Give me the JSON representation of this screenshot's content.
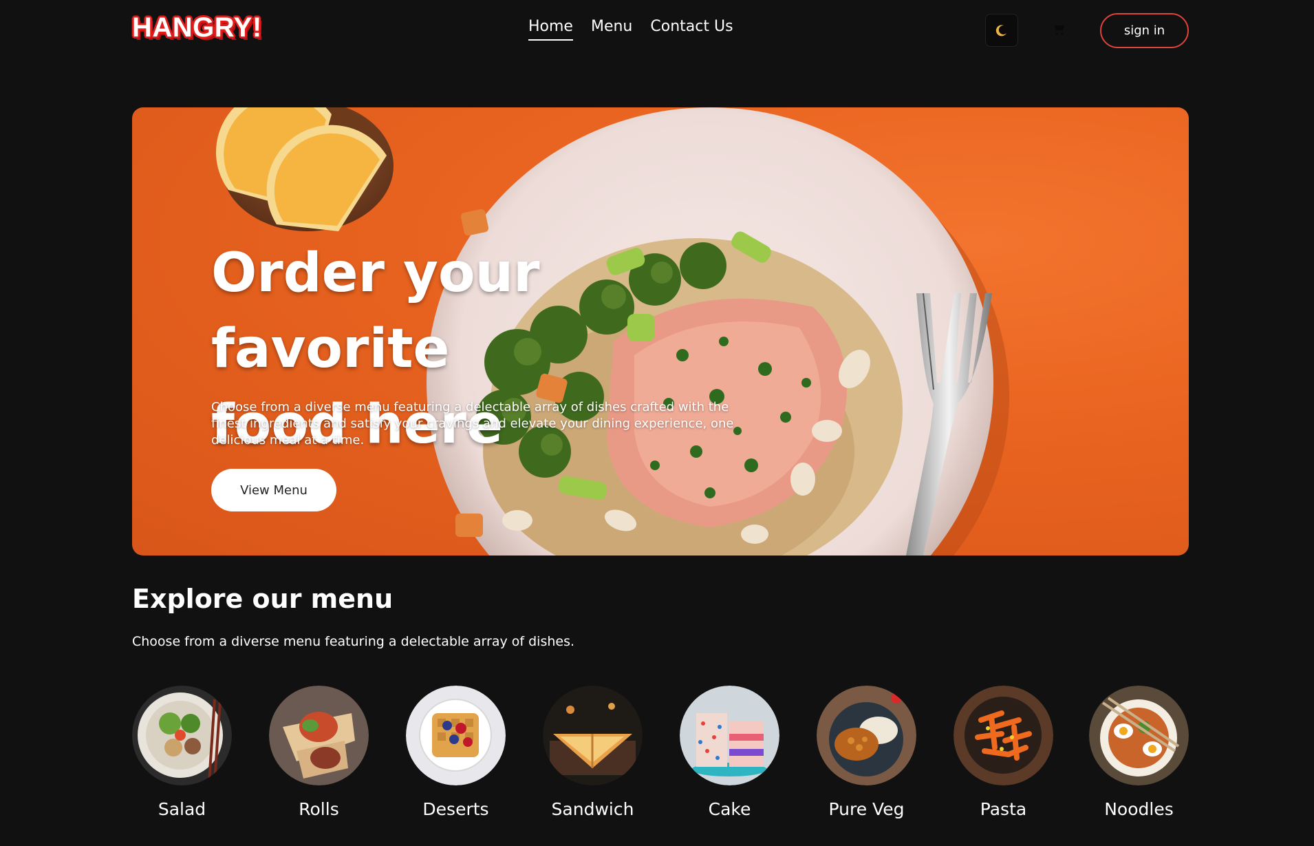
{
  "header": {
    "logo": "HANGRY!",
    "nav": [
      {
        "label": "Home",
        "active": true
      },
      {
        "label": "Menu",
        "active": false
      },
      {
        "label": "Contact Us",
        "active": false
      }
    ],
    "theme_icon": "moon-icon",
    "cart_icon": "cart-icon",
    "signin_label": "sign in"
  },
  "hero": {
    "title_line1": "Order your favorite",
    "title_line2": "food here",
    "description": "Choose from a diverse menu featuring a delectable array of dishes crafted with the finest ingredients and satisfy your cravings and elevate your dining experience, one delicious meal at a time.",
    "button_label": "View Menu"
  },
  "explore": {
    "title": "Explore our menu",
    "subtitle": "Choose from a diverse menu featuring a delectable array of dishes."
  },
  "categories": [
    {
      "label": "Salad"
    },
    {
      "label": "Rolls"
    },
    {
      "label": "Deserts"
    },
    {
      "label": "Sandwich"
    },
    {
      "label": "Cake"
    },
    {
      "label": "Pure Veg"
    },
    {
      "label": "Pasta"
    },
    {
      "label": "Noodles"
    }
  ],
  "colors": {
    "background": "#111112",
    "accent": "#e0433a",
    "hero_orange": "#e8631f",
    "moon": "#f0b43c"
  }
}
